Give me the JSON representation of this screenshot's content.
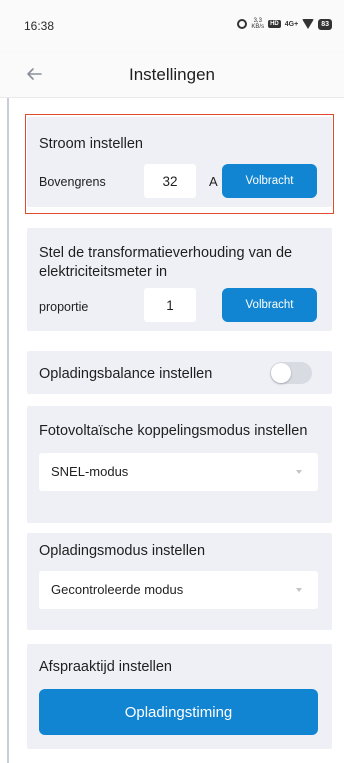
{
  "status_bar": {
    "time": "16:38",
    "speed_top": "3,3",
    "speed_bottom": "KB/s",
    "hd_label": "HD",
    "network": "4G+",
    "battery": "83"
  },
  "header": {
    "back_icon": "arrow-left-icon",
    "title": "Instellingen"
  },
  "current_settings": {
    "title": "Stroom instellen",
    "upper_limit_label": "Bovengrens",
    "upper_limit_value": "32",
    "unit": "A",
    "done_label": "Volbracht"
  },
  "ratio_settings": {
    "title_line1": "Stel de transformatieverhouding van de",
    "title_line2": "elektriciteitsmeter in",
    "ratio_label": "proportie",
    "ratio_value": "1",
    "done_label": "Volbracht"
  },
  "balance_settings": {
    "title": "Opladingsbalance instellen",
    "enabled": false
  },
  "pv_settings": {
    "title": "Fotovoltaïsche koppelingsmodus instellen",
    "selected": "SNEL-modus"
  },
  "mode_settings": {
    "title": "Opladingsmodus instellen",
    "selected": "Gecontroleerde modus"
  },
  "appointment_settings": {
    "title": "Afspraaktijd instellen",
    "button_label": "Opladingstiming"
  },
  "colors": {
    "accent": "#1184d2",
    "highlight": "#e04a2e",
    "card_bg": "#eef0f5"
  }
}
